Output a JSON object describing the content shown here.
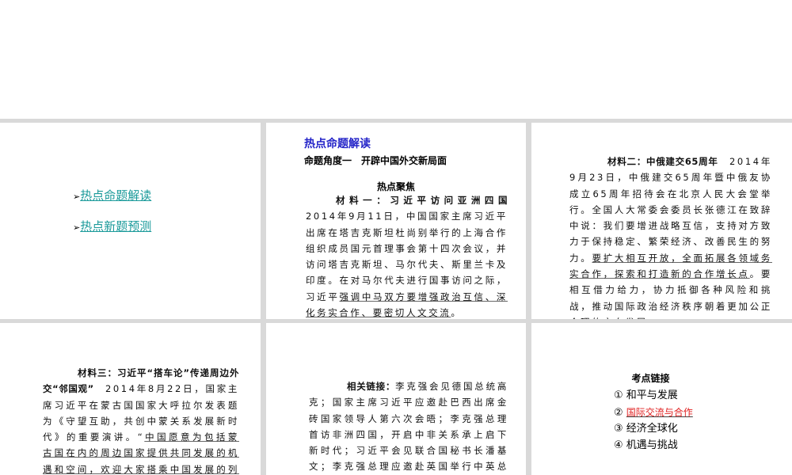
{
  "nav": {
    "arrow": "➢",
    "items": [
      "热点命题解读",
      "热点新题预测"
    ]
  },
  "panel2": {
    "title": "热点命题解读",
    "subtitle": "命题角度一　开辟中国外交新局面",
    "heading": "热点聚焦",
    "label": "材料一：习近平访问亚洲四国",
    "pre": "　　2014年9月11日，中国国家主席习近平出席在塔吉克斯坦杜尚别举行的上海合作组织成员国元首理事会第十四次会议，并访问塔吉克斯坦、马尔代夫、斯里兰卡及印度。在对马尔代夫进行国事访问之际，习近平",
    "u": "强调中马双方要增强政治互信、深化务实合作、要密切人文交流",
    "post": "。"
  },
  "panel3": {
    "label": "材料二：中俄建交65周年",
    "pre": "　2014年9月23日，中俄建交65周年暨中俄友协成立65周年招待会在北京人民大会堂举行。全国人大常委会委员长张德江在致辞中说：我们要增进战略互信，支持对方致力于保持稳定、繁荣经济、改善民生的努力。",
    "u": "要扩大相互开放，全面拓展各领域务实合作，探索和打造新的合作增长点",
    "post": "。要相互借力给力，协力抵御各种风险和挑战，推动国际政治经济秩序朝着更加公正合理的方向发展。"
  },
  "panel4": {
    "label": "材料三：习近平“搭车论”传递周边外交“邻国观”",
    "pre": "　2014年8月22日，国家主席习近平在蒙古国国家大呼拉尔发表题为《守望互助，共创中蒙关系发展新时代》的重要演讲。“",
    "u": "中国愿意为包括蒙古国在内的周边国家提供共同发展的机遇和空间，欢迎大家搭乘中国发展的列车，搭快车也好，搭便车也好，我"
  },
  "panel5": {
    "label": "相关链接：",
    "text": "李克强会见德国总统高克；国家主席习近平应邀赴巴西出席金砖国家领导人第六次会晤；李克强总理首访非洲四国，开启中非关系承上启下新时代；习近平会见联合国秘书长潘基文；李克强总理应邀赴英国举行中英总理年度会晤。"
  },
  "panel6": {
    "heading": "考点链接",
    "items": [
      {
        "num": "①",
        "text": "和平与发展"
      },
      {
        "num": "②",
        "text": "国际交流与合作"
      },
      {
        "num": "③",
        "text": "经济全球化"
      },
      {
        "num": "④",
        "text": "机遇与挑战"
      }
    ]
  }
}
